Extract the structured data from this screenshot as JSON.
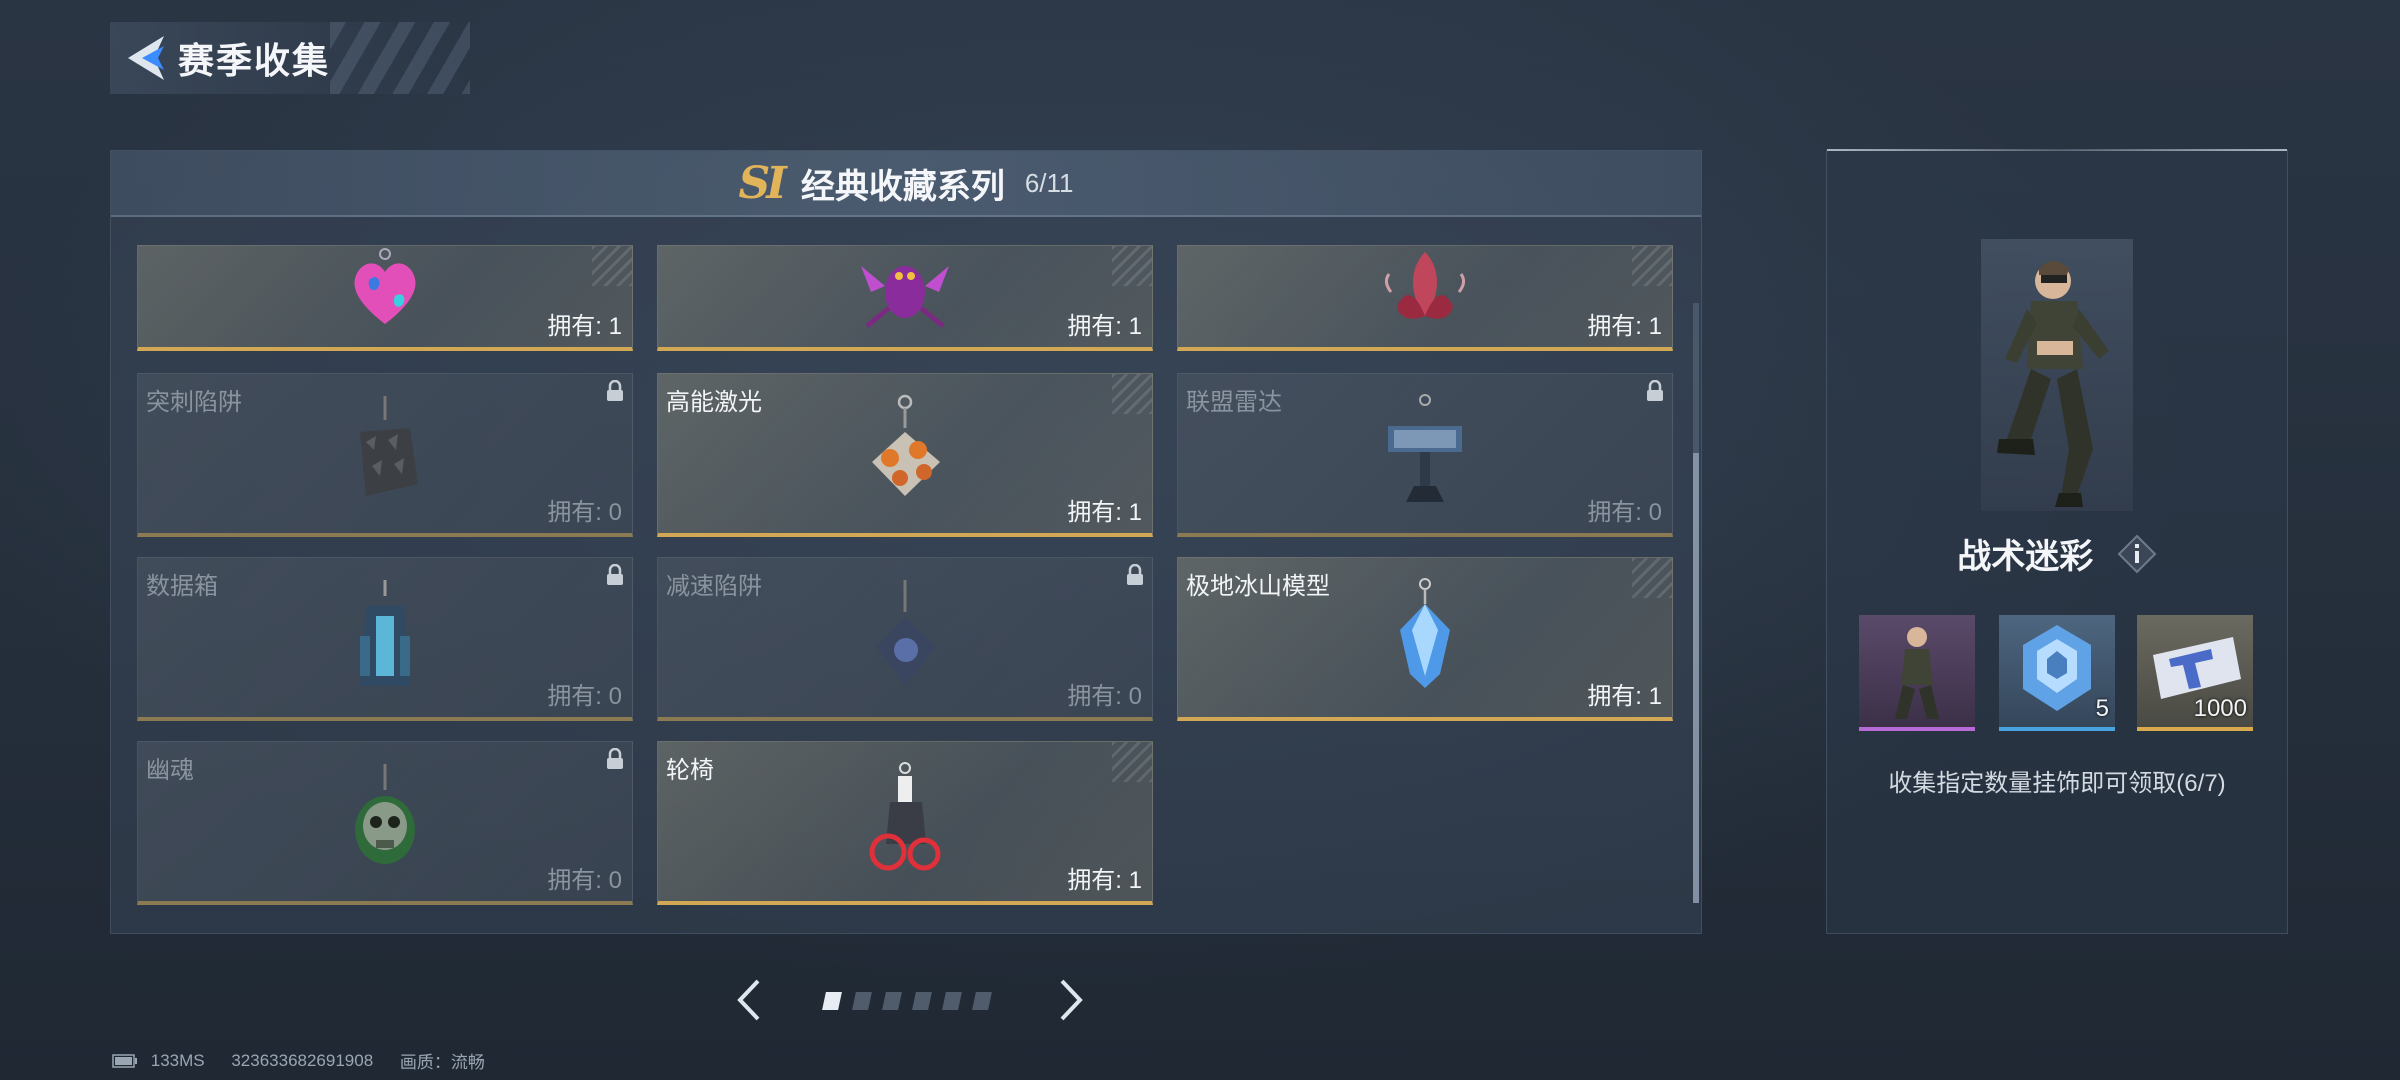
{
  "header": {
    "title": "赛季收集",
    "back_icon": "back-arrow-icon"
  },
  "series": {
    "logo": "SI",
    "title": "经典收藏系列",
    "count": "6/11"
  },
  "items": [
    {
      "name": "",
      "owned_label": "拥有: 1",
      "locked": false,
      "icon": "pink-heart-charm-icon"
    },
    {
      "name": "",
      "owned_label": "拥有: 1",
      "locked": false,
      "icon": "purple-bug-charm-icon"
    },
    {
      "name": "",
      "owned_label": "拥有: 1",
      "locked": false,
      "icon": "red-flower-charm-icon"
    },
    {
      "name": "突刺陷阱",
      "owned_label": "拥有: 0",
      "locked": true,
      "icon": "spike-trap-charm-icon"
    },
    {
      "name": "高能激光",
      "owned_label": "拥有: 1",
      "locked": false,
      "icon": "laser-charm-icon"
    },
    {
      "name": "联盟雷达",
      "owned_label": "拥有: 0",
      "locked": true,
      "icon": "radar-charm-icon"
    },
    {
      "name": "数据箱",
      "owned_label": "拥有: 0",
      "locked": true,
      "icon": "data-box-charm-icon"
    },
    {
      "name": "减速陷阱",
      "owned_label": "拥有: 0",
      "locked": true,
      "icon": "slow-trap-charm-icon"
    },
    {
      "name": "极地冰山模型",
      "owned_label": "拥有: 1",
      "locked": false,
      "icon": "iceberg-charm-icon"
    },
    {
      "name": "幽魂",
      "owned_label": "拥有: 0",
      "locked": true,
      "icon": "ghost-skull-charm-icon"
    },
    {
      "name": "轮椅",
      "owned_label": "拥有: 1",
      "locked": false,
      "icon": "wheelchair-charm-icon"
    }
  ],
  "pagination": {
    "total": 6,
    "current": 1
  },
  "reward": {
    "name": "战术迷彩",
    "items": [
      {
        "icon": "character-skin-icon",
        "qty": "",
        "accent": "#b86ad6"
      },
      {
        "icon": "blue-crystal-icon",
        "qty": "5",
        "accent": "#4aa3e0"
      },
      {
        "icon": "ticket-icon",
        "qty": "1000",
        "accent": "#d9a94e"
      }
    ],
    "description": "收集指定数量挂饰即可领取(6/7)"
  },
  "footer": {
    "ping": "133MS",
    "uid": "323633682691908",
    "quality": "画质：流畅"
  },
  "colors": {
    "gold_accent": "#d2a855",
    "locked_text": "#8a949f",
    "background": "#26303d"
  }
}
